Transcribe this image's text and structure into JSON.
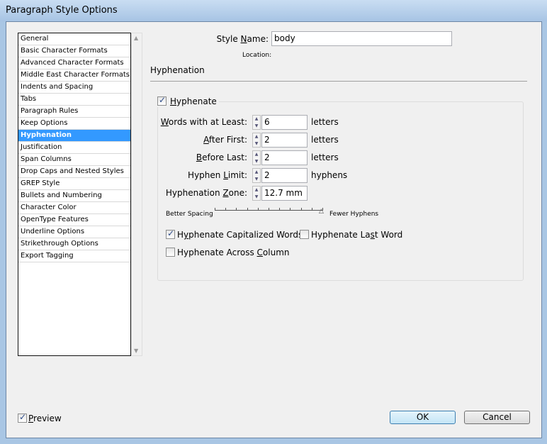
{
  "window": {
    "title": "Paragraph Style Options"
  },
  "sidebar": {
    "items": [
      "General",
      "Basic Character Formats",
      "Advanced Character Formats",
      "Middle East Character Formats",
      "Indents and Spacing",
      "Tabs",
      "Paragraph Rules",
      "Keep Options",
      "Hyphenation",
      "Justification",
      "Span Columns",
      "Drop Caps and Nested Styles",
      "GREP Style",
      "Bullets and Numbering",
      "Character Color",
      "OpenType Features",
      "Underline Options",
      "Strikethrough Options",
      "Export Tagging"
    ],
    "selected": "Hyphenation"
  },
  "style_name": {
    "pre": "Style ",
    "key": "N",
    "post": "ame:",
    "value": "body"
  },
  "location_label": "Location:",
  "section_title": "Hyphenation",
  "hyphenate": {
    "pre": "",
    "key": "H",
    "post": "yphenate",
    "checked": true
  },
  "fields": [
    {
      "pre": "",
      "key": "W",
      "post": "ords with at Least:",
      "value": "6",
      "unit": "letters"
    },
    {
      "pre": "",
      "key": "A",
      "post": "fter First:",
      "value": "2",
      "unit": "letters"
    },
    {
      "pre": "",
      "key": "B",
      "post": "efore Last:",
      "value": "2",
      "unit": "letters"
    },
    {
      "pre": "Hyphen ",
      "key": "L",
      "post": "imit:",
      "value": "2",
      "unit": "hyphens"
    },
    {
      "pre": "Hyphenation ",
      "key": "Z",
      "post": "one:",
      "value": "12.7 mm",
      "unit": ""
    }
  ],
  "slider": {
    "left_label": "Better Spacing",
    "right_label": "Fewer Hyphens",
    "value_percent": 100
  },
  "options": [
    {
      "pre": "H",
      "key": "y",
      "post": "phenate Capitalized Words",
      "checked": true
    },
    {
      "pre": "Hyphenate La",
      "key": "s",
      "post": "t Word",
      "checked": false
    },
    {
      "pre": "Hyphenate Across ",
      "key": "C",
      "post": "olumn",
      "checked": false
    }
  ],
  "preview": {
    "pre": "",
    "key": "P",
    "post": "review",
    "checked": true
  },
  "buttons": {
    "ok": "OK",
    "cancel": "Cancel"
  }
}
